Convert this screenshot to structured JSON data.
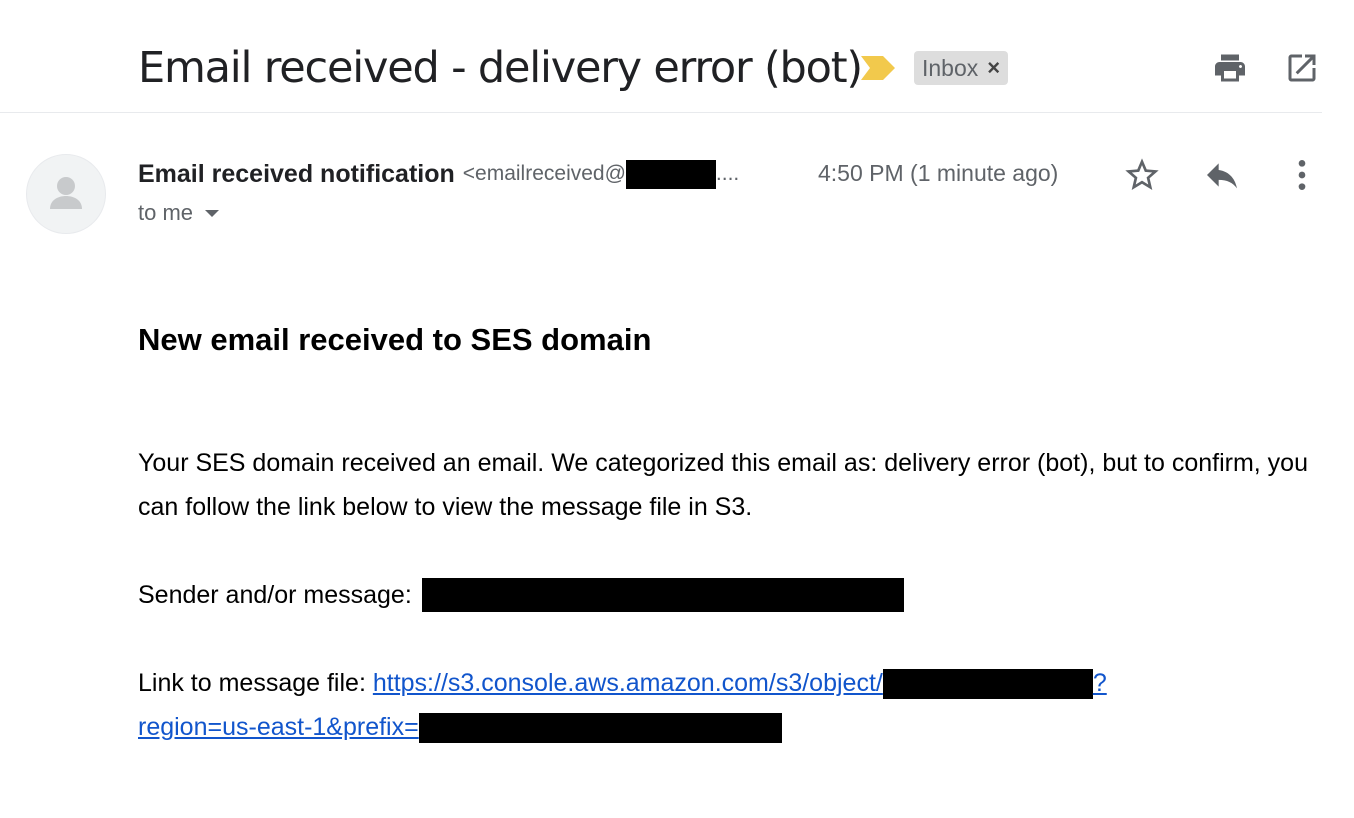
{
  "email": {
    "subject": "Email received - delivery error (bot)",
    "label_chip": {
      "label": "Inbox",
      "remove": "×"
    },
    "sender": {
      "name": "Email received notification",
      "email_prefix": "<emailreceived@",
      "email_truncation": "...."
    },
    "timestamp": "4:50 PM (1 minute ago)",
    "recipient": "to me"
  },
  "body": {
    "heading": "New email received to SES domain",
    "paragraph": "Your SES domain received an email. We categorized this email as: delivery error (bot), but to confirm, you can follow the link below to view the message file in S3.",
    "sender_label": "Sender and/or message:",
    "link_label": "Link to message file:",
    "link_part1": "https://s3.console.aws.amazon.com/s3/object/",
    "link_part2": "?",
    "link_part3": "region=us-east-1&prefix="
  },
  "icons": {
    "importance": "importance-marker-icon",
    "print": "print-icon",
    "open_new_window": "open-in-new-window-icon",
    "star": "star-icon",
    "reply": "reply-icon",
    "more": "more-vertical-icon",
    "avatar": "person-avatar-icon"
  },
  "colors": {
    "importance": "#f2c94c",
    "link": "#1155cc",
    "chip_bg": "#dddddd",
    "muted_text": "#5f6368"
  }
}
